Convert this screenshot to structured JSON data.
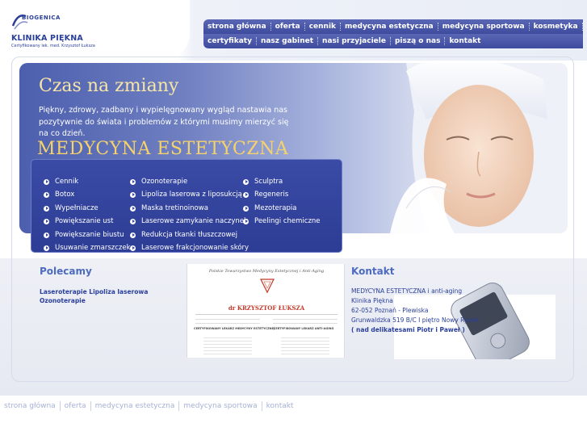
{
  "logo": {
    "brand": "BIOGENICA",
    "name": "KLINIKA PIĘKNA",
    "subtitle": "Certyfikowany lek. med. Krzysztof Łuksza"
  },
  "nav": {
    "row1": [
      "strona główna",
      "oferta",
      "cennik",
      "medycyna estetyczna",
      "medycyna sportowa",
      "kosmetyka"
    ],
    "row2": [
      "certyfikaty",
      "nasz gabinet",
      "nasi przyjaciele",
      "piszą o nas",
      "kontakt"
    ]
  },
  "hero": {
    "title": "Czas na zmiany",
    "text": "Piękny, zdrowy, zadbany i wypielęgnowany wygląd nastawia nas pozytywnie do świata i problemów z którymi musimy mierzyć się na co dzień.",
    "subtitle": "MEDYCYNA ESTETYCZNA"
  },
  "submenu": {
    "col1": [
      "Cennik",
      "Botox",
      "Wypełniacze",
      "Powiększanie ust",
      "Powiększanie biustu",
      "Usuwanie zmarszczek"
    ],
    "col2": [
      "Ozonoterapie",
      "Lipoliza laserowa z liposukcją",
      "Maska tretinoinowa",
      "Laserowe zamykanie naczynek",
      "Redukcja tkanki tłuszczowej",
      "Laserowe frakcjonowanie skóry"
    ],
    "col3": [
      "Sculptra",
      "Regeneris",
      "Mezoterapia",
      "Peelingi chemiczne"
    ]
  },
  "polecamy": {
    "title": "Polecamy",
    "links": [
      "Laseroterapie Lipoliza laserowa",
      "Ozonoterapie"
    ]
  },
  "certificate": {
    "org": "Polskie Towarzystwo Medycyny Estetycznej i Anti-Aging",
    "name": "dr KRZYSZTOF ŁUKSZA",
    "left_heading": "CERTYFIKOWANY LEKARZ MEDYCYNY ESTETYCZNEJ",
    "right_heading": "CERTYFIKOWANY LEKARZ ANTI-AGING"
  },
  "kontakt": {
    "title": "Kontakt",
    "lines": [
      "MEDYCYNA ESTETYCZNA i anti-aging",
      "Klinika Piękna",
      "62-052 Poznań - Plewiska",
      "Grunwaldzka 519 B/C I piętro Nowy Rynek",
      "( nad delikatesami Piotr i Paweł )"
    ]
  },
  "footer": [
    "strona główna",
    "oferta",
    "medycyna estetyczna",
    "medycyna sportowa",
    "kontakt"
  ],
  "colors": {
    "brand_blue": "#2a3f9a",
    "nav_blue": "#4a58a8",
    "gold": "#f6d36a",
    "link_title": "#4d6bbf"
  }
}
